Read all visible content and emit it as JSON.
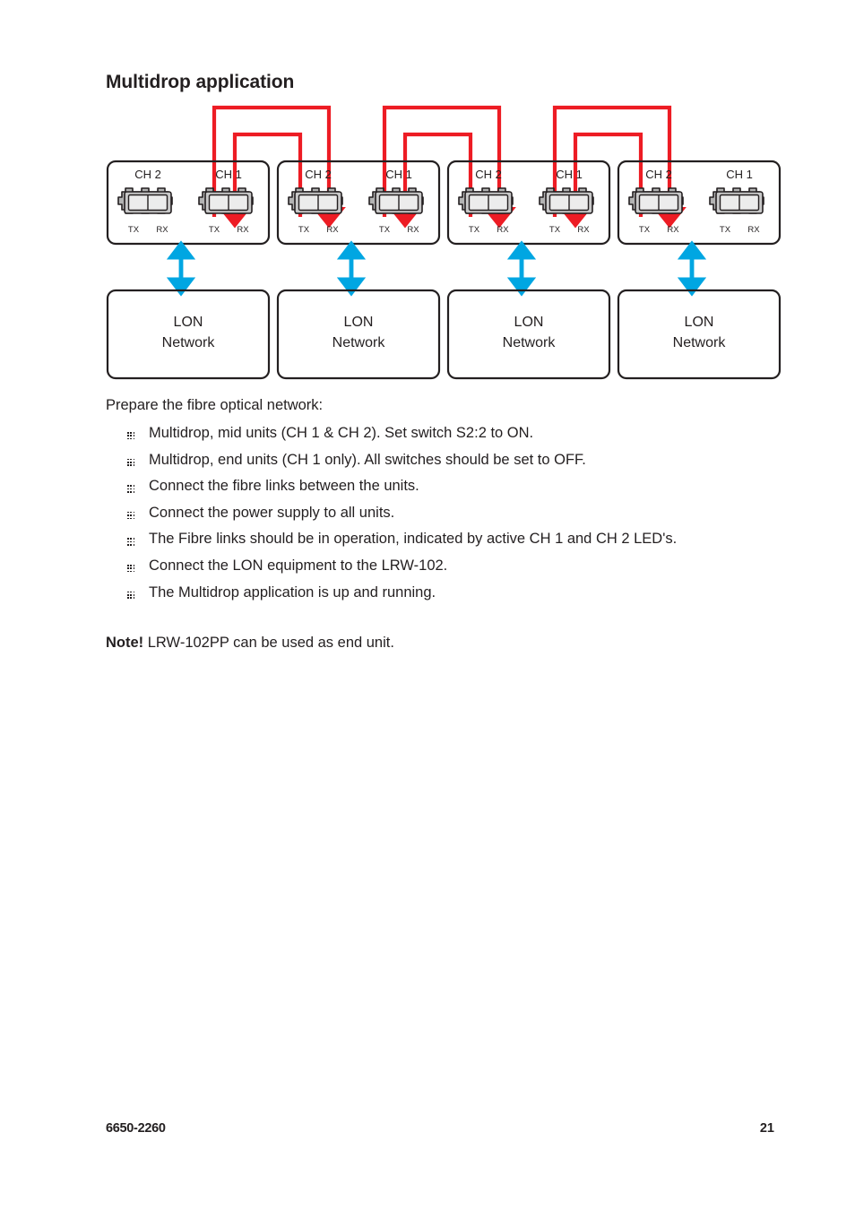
{
  "page": {
    "title": "Multidrop application",
    "intro": "Prepare the fibre optical network:",
    "note_label": "Note!",
    "note_text": "LRW-102PP can be used as end unit.",
    "footer_doc_number": "6650-2260",
    "footer_page_number": "21"
  },
  "bullets": [
    "Multidrop, mid units (CH 1 & CH 2). Set switch S2:2 to ON.",
    "Multidrop, end units (CH 1 only). All switches should be set to OFF.",
    "Connect the fibre links between the units.",
    "Connect the power supply to all units.",
    "The Fibre links should be in operation, indicated by active CH 1 and CH 2 LED's.",
    "Connect the LON equipment to the LRW-102.",
    "The Multidrop application is up and running."
  ],
  "diagram": {
    "units": [
      {
        "role": "end-unit",
        "channels": [
          {
            "name": "CH 2",
            "tx_label": "TX",
            "rx_label": "RX",
            "connected": false
          },
          {
            "name": "CH 1",
            "tx_label": "TX",
            "rx_label": "RX",
            "connected": true
          }
        ],
        "network_box": {
          "line1": "LON",
          "line2": "Network"
        }
      },
      {
        "role": "mid-unit",
        "channels": [
          {
            "name": "CH 2",
            "tx_label": "TX",
            "rx_label": "RX",
            "connected": true
          },
          {
            "name": "CH 1",
            "tx_label": "TX",
            "rx_label": "RX",
            "connected": true
          }
        ],
        "network_box": {
          "line1": "LON",
          "line2": "Network"
        }
      },
      {
        "role": "mid-unit",
        "channels": [
          {
            "name": "CH 2",
            "tx_label": "TX",
            "rx_label": "RX",
            "connected": true
          },
          {
            "name": "CH 1",
            "tx_label": "TX",
            "rx_label": "RX",
            "connected": true
          }
        ],
        "network_box": {
          "line1": "LON",
          "line2": "Network"
        }
      },
      {
        "role": "end-unit",
        "channels": [
          {
            "name": "CH 2",
            "tx_label": "TX",
            "rx_label": "RX",
            "connected": false
          },
          {
            "name": "CH 1",
            "tx_label": "TX",
            "rx_label": "RX",
            "connected": true
          }
        ],
        "network_box": {
          "line1": "LON",
          "line2": "Network"
        }
      }
    ],
    "colors": {
      "fibre_cable": "#ED1C24",
      "network_arrow": "#00A6E2",
      "outline": "#231f20",
      "connector_body": "#B3B3B3",
      "connector_port": "#ECECEC"
    }
  }
}
